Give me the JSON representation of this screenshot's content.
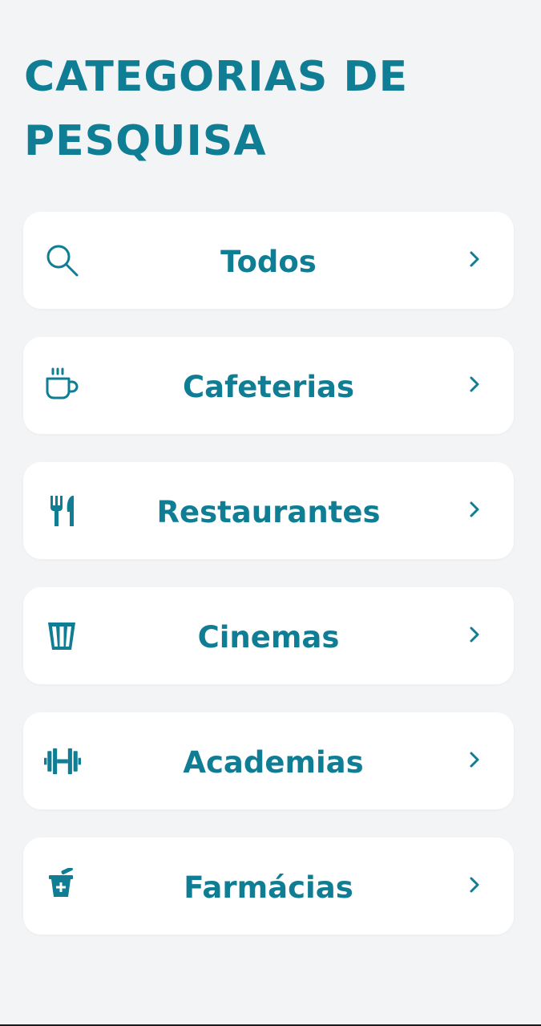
{
  "header": {
    "title_line1": "CATEGORIAS DE",
    "title_line2": "PESQUISA"
  },
  "categories": [
    {
      "label": "Todos",
      "icon": "search-icon"
    },
    {
      "label": "Cafeterias",
      "icon": "coffee-cup-icon"
    },
    {
      "label": "Restaurantes",
      "icon": "fork-knife-icon"
    },
    {
      "label": "Cinemas",
      "icon": "popcorn-icon"
    },
    {
      "label": "Academias",
      "icon": "dumbbell-icon"
    },
    {
      "label": "Farmácias",
      "icon": "pharmacy-mortar-icon"
    }
  ],
  "colors": {
    "accent": "#0f7e94",
    "background": "#f3f4f6",
    "card": "#ffffff"
  }
}
